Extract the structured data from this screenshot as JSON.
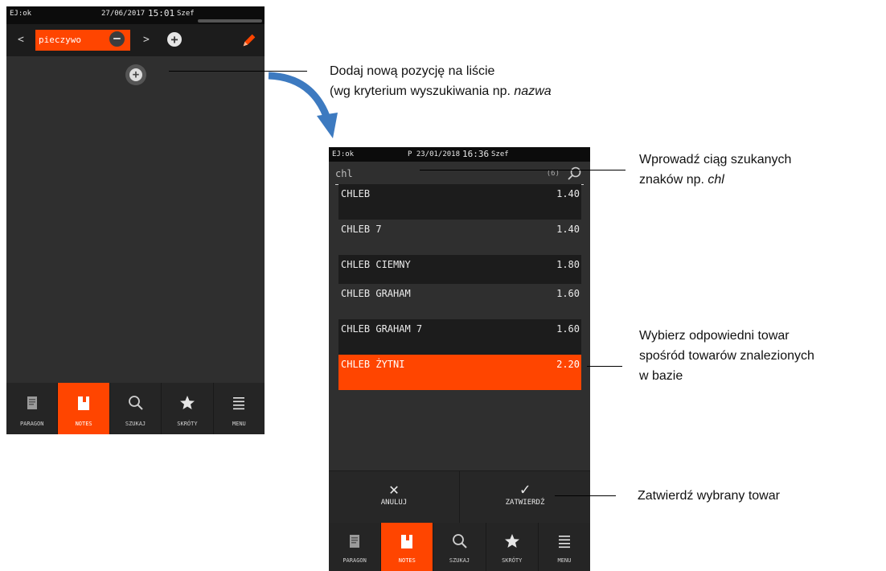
{
  "phone1": {
    "status": {
      "ej": "EJ:ok",
      "date": "27/06/2017",
      "time": "15:01",
      "user": "Szef"
    },
    "catbar": {
      "prev": "<",
      "next": ">",
      "category": "pieczywo",
      "minus": "−",
      "plus": "+"
    },
    "add_symbol": "+"
  },
  "phone2": {
    "status": {
      "ej": "EJ:ok",
      "date": "P 23/01/2018",
      "time": "16:36",
      "user": "Szef"
    },
    "search": {
      "value": "chl",
      "count": "(6)"
    },
    "items": [
      {
        "name": "CHLEB",
        "price": "1.40"
      },
      {
        "name": "CHLEB 7",
        "price": "1.40"
      },
      {
        "name": "CHLEB CIEMNY",
        "price": "1.80"
      },
      {
        "name": "CHLEB GRAHAM",
        "price": "1.60"
      },
      {
        "name": "CHLEB GRAHAM 7",
        "price": "1.60"
      },
      {
        "name": "CHLEB ŻYTNI",
        "price": "2.20"
      }
    ],
    "selected_index": 5,
    "actions": {
      "cancel": "ANULUJ",
      "confirm": "ZATWIERDŹ",
      "cancel_symbol": "✕",
      "confirm_symbol": "✓"
    }
  },
  "nav": {
    "paragon": "PARAGON",
    "notes": "NOTES",
    "szukaj": "SZUKAJ",
    "skroty": "SKRÓTY",
    "menu": "MENU"
  },
  "annotations": {
    "add_line1": "Dodaj nową pozycję na liście",
    "add_line2_prefix": "(wg kryterium wyszukiwania np. ",
    "add_line2_em": "nazwa",
    "search_line1": "Wprowadź ciąg szukanych",
    "search_line2_prefix": "znaków np. ",
    "search_line2_em": "chl",
    "select_line1": "Wybierz odpowiedni towar",
    "select_line2": "spośród towarów znalezionych",
    "select_line3": "w bazie",
    "confirm_line": "Zatwierdź wybrany towar"
  },
  "colors": {
    "accent": "#ff4500",
    "arrow": "#3d7ac0",
    "background": "#2f2f2f"
  },
  "icons": [
    "receipt-icon",
    "notebook-icon",
    "search-icon",
    "star-icon",
    "menu-icon",
    "pencil-icon",
    "plus-icon",
    "minus-icon",
    "close-icon",
    "check-icon"
  ]
}
